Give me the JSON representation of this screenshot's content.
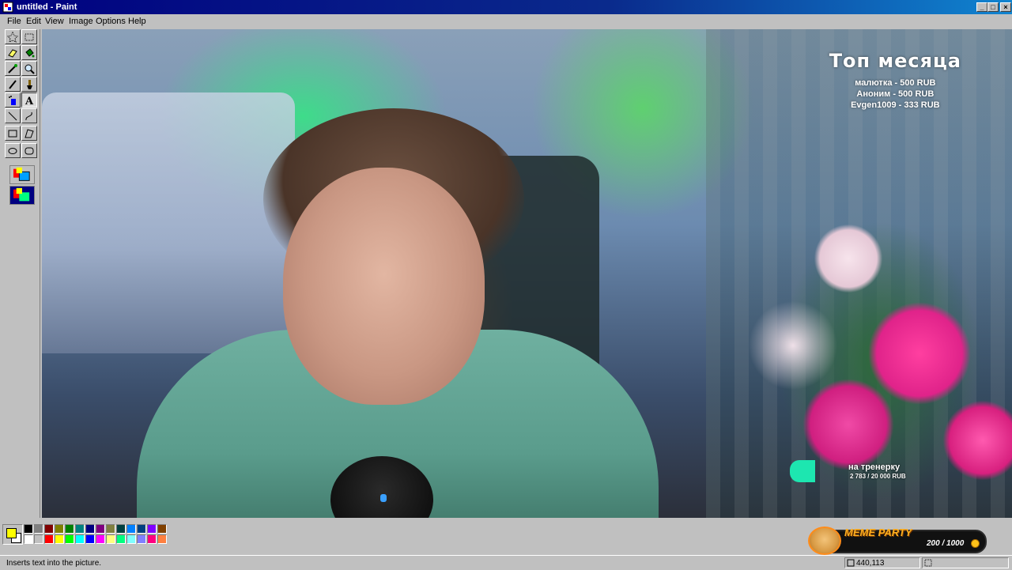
{
  "window": {
    "title": "untitled - Paint"
  },
  "menu": [
    "File",
    "Edit",
    "View",
    "Image",
    "Options",
    "Help"
  ],
  "tools": [
    "free-select",
    "select",
    "eraser",
    "fill",
    "picker",
    "magnifier",
    "pencil",
    "brush",
    "airbrush",
    "text",
    "line",
    "curve",
    "rectangle",
    "polygon",
    "ellipse",
    "rounded-rectangle"
  ],
  "active_tool": "text",
  "stream_overlay": {
    "top_heading": "Топ месяца",
    "top_donors": [
      "малютка - 500 RUB",
      "Аноним - 500 RUB",
      "Evgen1009 - 333 RUB"
    ],
    "goal_label": "на тренерку",
    "goal_value": "2 783 / 20 000 RUB",
    "goal_progress": 0.139,
    "meme_title": "MEME PARTY",
    "meme_count": "200 / 1000"
  },
  "palette": {
    "foreground": "#ffff00",
    "background": "#ffffff",
    "row1": [
      "#000000",
      "#808080",
      "#800000",
      "#808000",
      "#008000",
      "#008080",
      "#000080",
      "#800080",
      "#808040",
      "#004040",
      "#0080ff",
      "#004080",
      "#8000ff",
      "#804000"
    ],
    "row2": [
      "#ffffff",
      "#c0c0c0",
      "#ff0000",
      "#ffff00",
      "#00ff00",
      "#00ffff",
      "#0000ff",
      "#ff00ff",
      "#ffff80",
      "#00ff80",
      "#80ffff",
      "#8080ff",
      "#ff0080",
      "#ff8040"
    ]
  },
  "status": {
    "hint": "Inserts text into the picture.",
    "coords": "440,113"
  }
}
